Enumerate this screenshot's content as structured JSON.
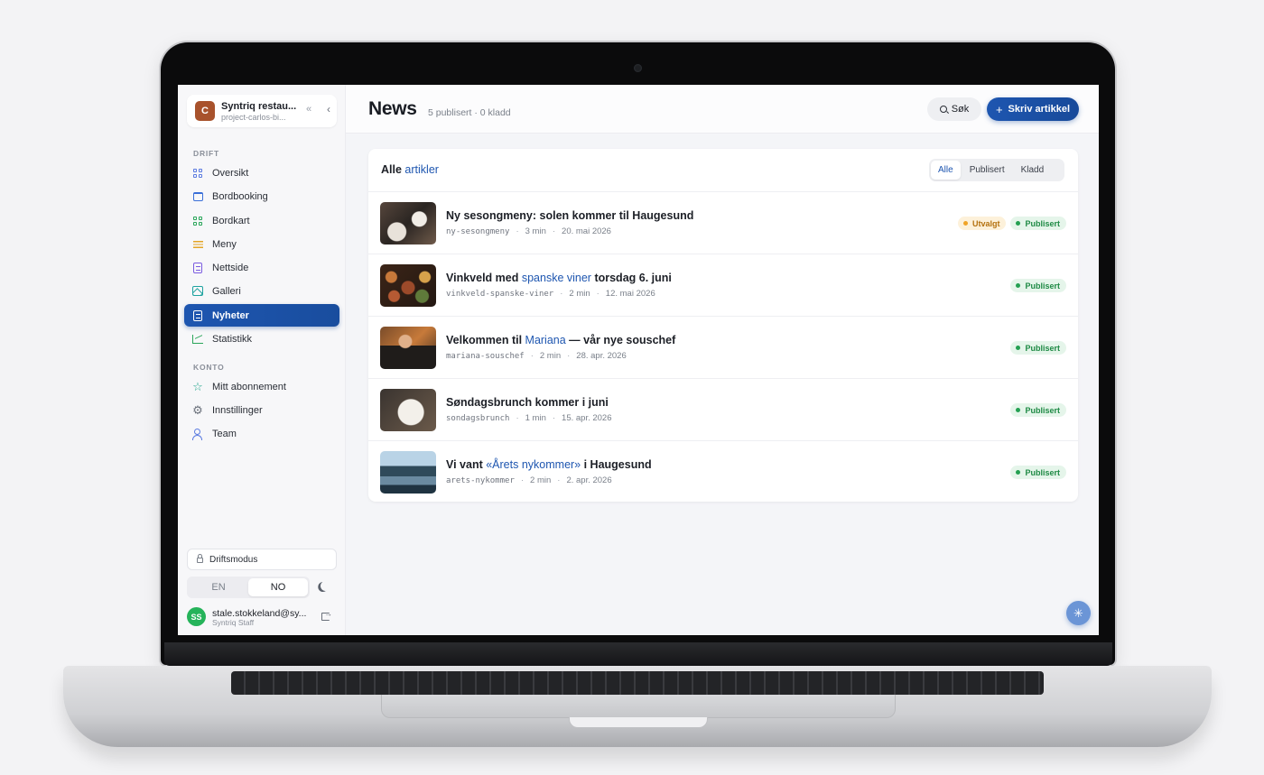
{
  "org": {
    "initial": "C",
    "name": "Syntriq restau...",
    "project": "project-carlos-bi..."
  },
  "sidebar": {
    "collapse_glyph": "«",
    "back_glyph": "‹",
    "sections": [
      {
        "label": "DRIFT"
      },
      {
        "label": "KONTO"
      }
    ],
    "items": [
      {
        "label": "Oversikt",
        "icon": "dashboard-icon",
        "color": "#5b7be0"
      },
      {
        "label": "Bordbooking",
        "icon": "calendar-icon",
        "color": "#3a6fd8"
      },
      {
        "label": "Bordkart",
        "icon": "table-grid-icon",
        "color": "#2aa55a"
      },
      {
        "label": "Meny",
        "icon": "menu-lines-icon",
        "color": "#e3a425"
      },
      {
        "label": "Nettside",
        "icon": "webpage-icon",
        "color": "#7b5ce0"
      },
      {
        "label": "Galleri",
        "icon": "image-icon",
        "color": "#1fa3a0"
      },
      {
        "label": "Nyheter",
        "icon": "news-icon",
        "color": "#ffffff",
        "active": true
      },
      {
        "label": "Statistikk",
        "icon": "chart-icon",
        "color": "#2aa55a"
      },
      {
        "label": "Mitt abonnement",
        "icon": "star-icon",
        "color": "#1fa38a"
      },
      {
        "label": "Innstillinger",
        "icon": "gear-icon",
        "color": "#6a707b"
      },
      {
        "label": "Team",
        "icon": "users-icon",
        "color": "#5b7be0"
      }
    ],
    "drift_mode": "Driftsmodus",
    "languages": [
      "EN",
      "NO"
    ],
    "active_language": "NO",
    "user": {
      "initials": "SS",
      "email": "stale.stokkeland@sy...",
      "role": "Syntriq Staff"
    }
  },
  "header": {
    "title": "News",
    "meta": "5 publisert · 0 kladd",
    "search_label": "Søk",
    "write_label": "Skriv artikkel"
  },
  "list": {
    "title_prefix": "Alle",
    "title_accent": "artikler",
    "filters": [
      "Alle",
      "Publisert",
      "Kladd"
    ],
    "active_filter": "Alle",
    "articles": [
      {
        "title": "Ny sesongmeny: solen kommer til Haugesund",
        "title_before": "Ny sesongmeny: solen kommer til Haugesund",
        "title_accent": "",
        "title_after": "",
        "slug": "ny-sesongmeny",
        "read_time": "3 min",
        "date": "20. mai 2026",
        "badges": [
          "Utvalgt",
          "Publisert"
        ]
      },
      {
        "title_before": "Vinkveld med ",
        "title_accent": "spanske viner",
        "title_after": " torsdag 6. juni",
        "slug": "vinkveld-spanske-viner",
        "read_time": "2 min",
        "date": "12. mai 2026",
        "badges": [
          "Publisert"
        ]
      },
      {
        "title_before": "Velkommen til ",
        "title_accent": "Mariana",
        "title_after": " — vår nye souschef",
        "slug": "mariana-souschef",
        "read_time": "2 min",
        "date": "28. apr. 2026",
        "badges": [
          "Publisert"
        ]
      },
      {
        "title_before": "Søndagsbrunch kommer i juni",
        "title_accent": "",
        "title_after": "",
        "slug": "sondagsbrunch",
        "read_time": "1 min",
        "date": "15. apr. 2026",
        "badges": [
          "Publisert"
        ]
      },
      {
        "title_before": "Vi vant ",
        "title_accent": "«Årets nykommer»",
        "title_after": " i Haugesund",
        "slug": "arets-nykommer",
        "read_time": "2 min",
        "date": "2. apr. 2026",
        "badges": [
          "Publisert"
        ]
      }
    ]
  },
  "fab_icon": "sparkle-icon",
  "colors": {
    "accent": "#1e56b0",
    "published": "#24a052",
    "featured": "#f0a326",
    "org_avatar": "#a8522c",
    "user_avatar": "#25b35a"
  }
}
